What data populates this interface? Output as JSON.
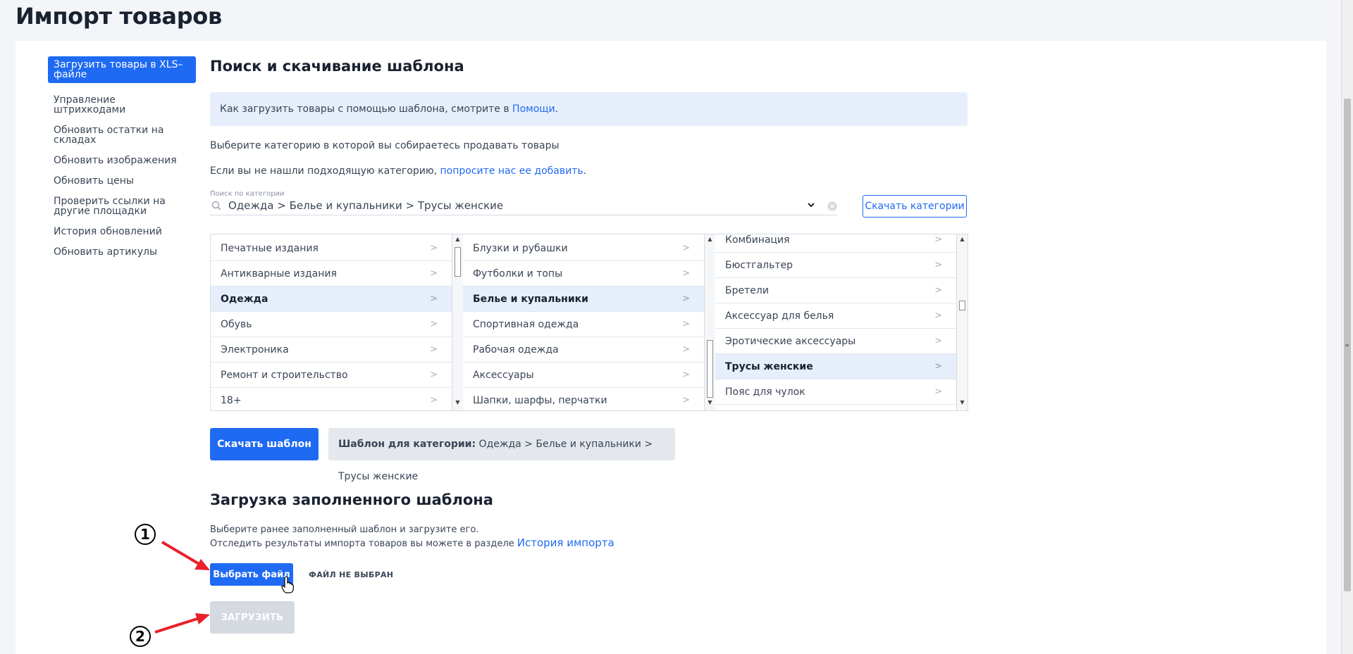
{
  "page": {
    "title": "Импорт товаров"
  },
  "sidebar": {
    "items": [
      {
        "label": "Загрузить товары в XLS–файле"
      },
      {
        "label": "Управление штрихкодами"
      },
      {
        "label": "Обновить остатки на складах"
      },
      {
        "label": "Обновить изображения"
      },
      {
        "label": "Обновить цены"
      },
      {
        "label": "Проверить ссылки на другие площадки"
      },
      {
        "label": "История обновлений"
      },
      {
        "label": "Обновить артикулы"
      }
    ],
    "active_index": 0
  },
  "search_section": {
    "heading": "Поиск и скачивание шаблона",
    "info_text": "Как загрузить товары с помощью шаблона, смотрите в",
    "info_link": "Помощи",
    "info_suffix": ".",
    "choose_text": "Выберите категорию в которой вы собираетесь продавать товары",
    "notfound_text": "Если вы не нашли подходящую категорию,",
    "notfound_link": "попросите нас ее добавить",
    "notfound_suffix": ".",
    "search_label": "Поиск по категории",
    "search_value": "Одежда > Белье и купальники > Трусы женские",
    "download_categories_label": "Скачать категории"
  },
  "categories": {
    "col1": [
      {
        "label": "Печатные издания",
        "selected": false
      },
      {
        "label": "Антикварные издания",
        "selected": false
      },
      {
        "label": "Одежда",
        "selected": true
      },
      {
        "label": "Обувь",
        "selected": false
      },
      {
        "label": "Электроника",
        "selected": false
      },
      {
        "label": "Ремонт и строительство",
        "selected": false
      },
      {
        "label": "18+",
        "selected": false
      }
    ],
    "col2": [
      {
        "label": "Блузки и рубашки",
        "selected": false
      },
      {
        "label": "Футболки и топы",
        "selected": false
      },
      {
        "label": "Белье и купальники",
        "selected": true
      },
      {
        "label": "Спортивная одежда",
        "selected": false
      },
      {
        "label": "Рабочая одежда",
        "selected": false
      },
      {
        "label": "Аксессуары",
        "selected": false
      },
      {
        "label": "Шапки, шарфы, перчатки",
        "selected": false
      }
    ],
    "col3": [
      {
        "label": "Комбинация",
        "selected": false
      },
      {
        "label": "Бюстгальтер",
        "selected": false
      },
      {
        "label": "Бретели",
        "selected": false
      },
      {
        "label": "Аксессуар для белья",
        "selected": false
      },
      {
        "label": "Эротические аксессуары",
        "selected": false
      },
      {
        "label": "Трусы женские",
        "selected": true
      },
      {
        "label": "Пояс для чулок",
        "selected": false
      }
    ]
  },
  "template": {
    "download_label": "Скачать шаблон",
    "category_prefix": "Шаблон для категории:",
    "category_value": "Одежда > Белье и купальники > Трусы женские"
  },
  "upload_section": {
    "heading": "Загрузка заполненного шаблона",
    "line1": "Выберите ранее заполненный шаблон и загрузите его.",
    "line2": "Отследить результаты импорта товаров вы можете в разделе",
    "history_link": "История импорта",
    "choose_file_label": "Выбрать файл",
    "no_file_label": "ФАЙЛ НЕ ВЫБРАН",
    "upload_label": "ЗАГРУЗИТЬ"
  },
  "annotations": {
    "step1": "1",
    "step2": "2",
    "arrow_color": "#e8212b"
  },
  "colors": {
    "accent": "#1f6af2",
    "selected_bg": "#e6eefb"
  }
}
